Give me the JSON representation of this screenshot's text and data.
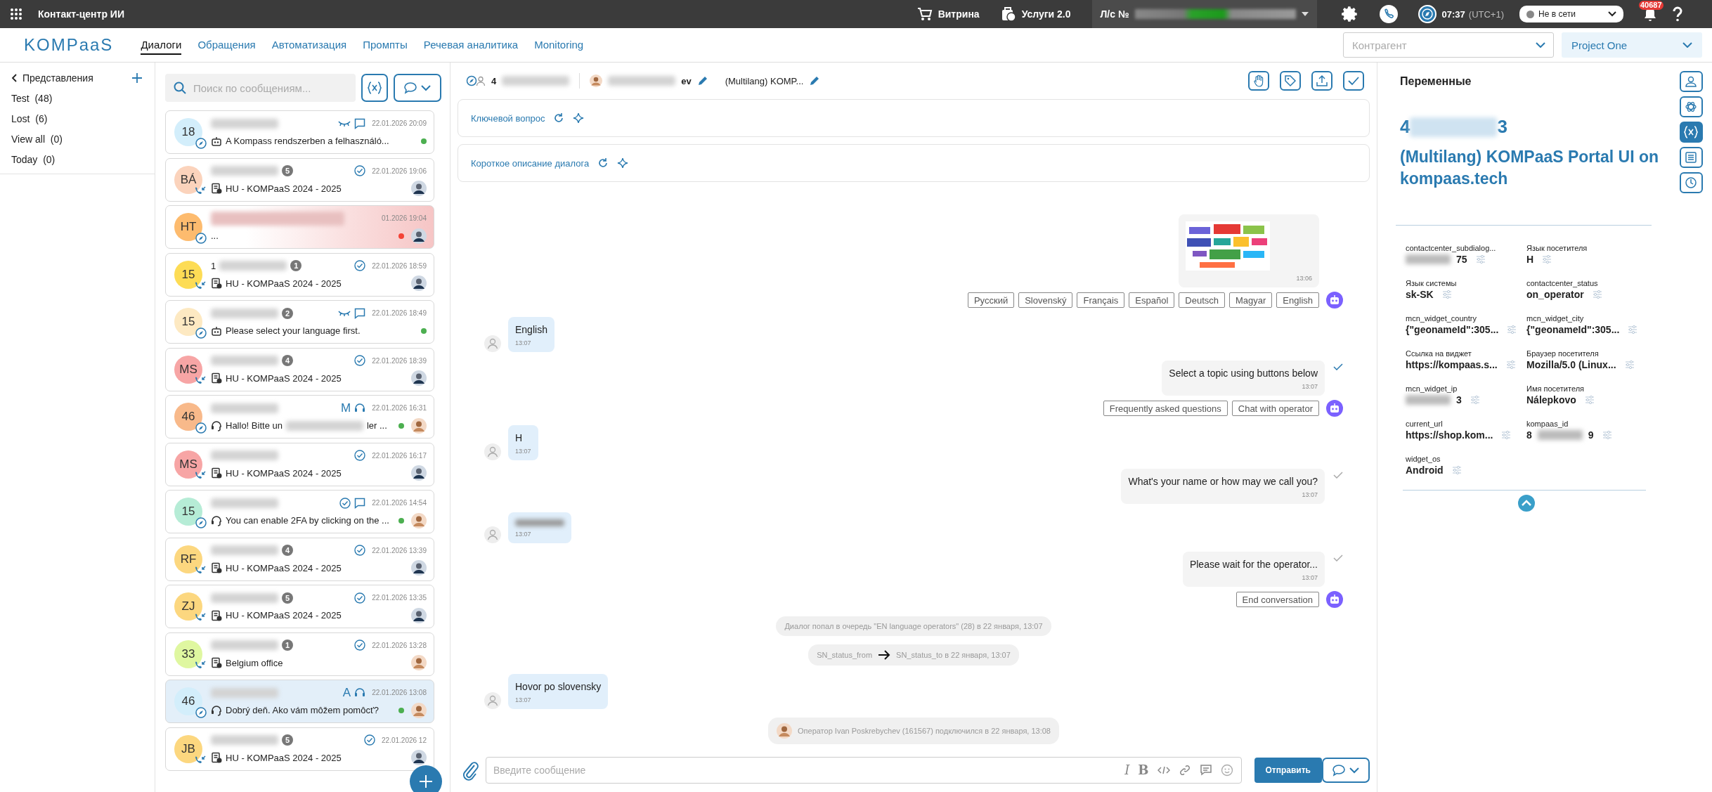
{
  "topbar": {
    "app_title": "Контакт-центр ИИ",
    "links": [
      {
        "label": "Витрина",
        "kind": "cart"
      },
      {
        "label": "Услуги 2.0",
        "kind": "services"
      }
    ],
    "account": {
      "head": "Л/с №"
    },
    "time": "07:37",
    "timezone": "(UTC+1)",
    "status": {
      "label": "Не в сети",
      "online": false
    },
    "notifications": "40687"
  },
  "nav": {
    "logo": "KOMPaaS",
    "tabs": [
      {
        "label": "Диалоги",
        "selected": true
      },
      {
        "label": "Обращения",
        "selected": false
      },
      {
        "label": "Автоматизация",
        "selected": false
      },
      {
        "label": "Промпты",
        "selected": false
      },
      {
        "label": "Речевая аналитика",
        "selected": false
      },
      {
        "label": "Monitoring",
        "selected": false
      }
    ],
    "counterparty": {
      "placeholder": "Контрагент"
    },
    "project": "Project One"
  },
  "views": {
    "title": "Представления",
    "items": [
      {
        "label": "Test",
        "count": "(48)"
      },
      {
        "label": "Lost",
        "count": "(6)"
      },
      {
        "label": "View all",
        "count": "(0)"
      },
      {
        "label": "Today",
        "count": "(0)"
      }
    ]
  },
  "search": {
    "placeholder": "Поиск по сообщениям..."
  },
  "dialogs": [
    {
      "initials": "18",
      "color": "#d3eefb",
      "channel": {
        "kind": "widget"
      },
      "markers": [
        {
          "kind": "eye"
        },
        {
          "kind": "chat"
        }
      ],
      "date": "22.01.2026 20:09",
      "preview_icon": {
        "kind": "bot"
      },
      "preview": "A Kompass rendszerben a felhasználó...",
      "dot": {
        "color": "#4caf50"
      },
      "selected": false,
      "alert": false
    },
    {
      "initials": "BÁ",
      "color": "#fbd3bc",
      "channel": {
        "kind": "phone"
      },
      "badge": "5",
      "markers": [
        {
          "kind": "check"
        }
      ],
      "date": "22.01.2026 19:06",
      "preview_icon": {
        "kind": "task"
      },
      "preview": "HU - KOMPaaS 2024 - 2025",
      "operator": {
        "kind": "dark"
      },
      "selected": false,
      "alert": false
    },
    {
      "initials": "HT",
      "color": "#fdbb6e",
      "channel": {
        "kind": "widget"
      },
      "date": "01.2026 19:04",
      "preview": "...",
      "dot": {
        "color": "#f44336"
      },
      "operator": {
        "kind": "dark"
      },
      "selected": false,
      "alert": true
    },
    {
      "initials": "15",
      "color": "#fddc55",
      "channel": {
        "kind": "phone"
      },
      "name_head": "1",
      "badge": "1",
      "markers": [
        {
          "kind": "check"
        }
      ],
      "date": "22.01.2026 18:59",
      "preview_icon": {
        "kind": "task"
      },
      "preview": "HU - KOMPaaS 2024 - 2025",
      "operator": {
        "kind": "dark"
      },
      "selected": false,
      "alert": false
    },
    {
      "initials": "15",
      "color": "#fde9c2",
      "channel": {
        "kind": "widget"
      },
      "badge": "2",
      "markers": [
        {
          "kind": "eye"
        },
        {
          "kind": "chat"
        }
      ],
      "date": "22.01.2026 18:49",
      "preview_icon": {
        "kind": "bot"
      },
      "preview": "Please select your language first.",
      "dot": {
        "color": "#4caf50"
      },
      "selected": false,
      "alert": false
    },
    {
      "initials": "MS",
      "color": "#f7a5a5",
      "channel": {
        "kind": "phone"
      },
      "badge": "4",
      "markers": [
        {
          "kind": "check"
        }
      ],
      "date": "22.01.2026 18:39",
      "preview_icon": {
        "kind": "task"
      },
      "preview": "HU - KOMPaaS 2024 - 2025",
      "operator": {
        "kind": "dark"
      },
      "selected": false,
      "alert": false
    },
    {
      "initials": "46",
      "color": "#f8b98a",
      "channel": {
        "kind": "widget"
      },
      "letter": "M",
      "markers": [
        {
          "kind": "headset"
        }
      ],
      "date": "22.01.2026 16:31",
      "preview_icon": {
        "kind": "headset"
      },
      "preview": "Hallo! Bitte un",
      "preview_tail": "ler ...",
      "dot": {
        "color": "#4caf50"
      },
      "operator": {
        "kind": "light"
      },
      "selected": false,
      "alert": false
    },
    {
      "initials": "MS",
      "color": "#f7a5a5",
      "channel": {
        "kind": "phone"
      },
      "markers": [
        {
          "kind": "check"
        }
      ],
      "date": "22.01.2026 16:17",
      "preview_icon": {
        "kind": "task"
      },
      "preview": "HU - KOMPaaS 2024 - 2025",
      "operator": {
        "kind": "dark"
      },
      "selected": false,
      "alert": false
    },
    {
      "initials": "15",
      "color": "#b6ecd6",
      "channel": {
        "kind": "widget"
      },
      "markers": [
        {
          "kind": "check"
        },
        {
          "kind": "chat"
        }
      ],
      "date": "22.01.2026 14:54",
      "preview_icon": {
        "kind": "headset"
      },
      "preview": "You can enable 2FA by clicking on the ...",
      "dot": {
        "color": "#4caf50"
      },
      "operator": {
        "kind": "light"
      },
      "selected": false,
      "alert": false
    },
    {
      "initials": "RF",
      "color": "#fcd77f",
      "channel": {
        "kind": "phone"
      },
      "badge": "4",
      "markers": [
        {
          "kind": "check"
        }
      ],
      "date": "22.01.2026 13:39",
      "preview_icon": {
        "kind": "task"
      },
      "preview": "HU - KOMPaaS 2024 - 2025",
      "operator": {
        "kind": "dark"
      },
      "selected": false,
      "alert": false
    },
    {
      "initials": "ZJ",
      "color": "#fcd77f",
      "channel": {
        "kind": "phone"
      },
      "badge": "5",
      "markers": [
        {
          "kind": "check"
        }
      ],
      "date": "22.01.2026 13:35",
      "preview_icon": {
        "kind": "task"
      },
      "preview": "HU - KOMPaaS 2024 - 2025",
      "operator": {
        "kind": "dark"
      },
      "selected": false,
      "alert": false
    },
    {
      "initials": "33",
      "color": "#dff7a0",
      "channel": {
        "kind": "phone"
      },
      "badge": "1",
      "markers": [
        {
          "kind": "check"
        }
      ],
      "date": "22.01.2026 13:28",
      "preview_icon": {
        "kind": "task"
      },
      "preview": "Belgium office",
      "operator": {
        "kind": "light"
      },
      "selected": false,
      "alert": false
    },
    {
      "initials": "46",
      "color": "#d3eefb",
      "channel": {
        "kind": "widget"
      },
      "letter": "A",
      "markers": [
        {
          "kind": "headset"
        }
      ],
      "date": "22.01.2026 13:08",
      "preview_icon": {
        "kind": "headset"
      },
      "preview": "Dobrý deň. Ako vám môžem pomôcť?",
      "dot": {
        "color": "#4caf50"
      },
      "operator": {
        "kind": "light"
      },
      "selected": true,
      "alert": false
    },
    {
      "initials": "JB",
      "color": "#fcd77f",
      "channel": {
        "kind": "phone"
      },
      "badge": "5",
      "markers": [
        {
          "kind": "check"
        }
      ],
      "date": "22.01.2026 12",
      "preview_icon": {
        "kind": "task"
      },
      "preview": "HU - KOMPaaS 2024 - 2025",
      "operator": {
        "kind": "dark"
      },
      "selected": false,
      "alert": false
    }
  ],
  "chat": {
    "header": {
      "contact_head": "4",
      "operator_tail": "ev",
      "title": "(Multilang) KOMP..."
    },
    "summaries": [
      {
        "label": "Ключевой вопрос"
      },
      {
        "label": "Короткое описание диалога"
      }
    ],
    "messages": [
      {
        "time": "13:06"
      },
      {
        "kind": "buttons",
        "buttons": [
          "Русский",
          "Slovenský",
          "Français",
          "Español",
          "Deutsch",
          "Magyar",
          "English"
        ]
      },
      {
        "kind": "user",
        "text": "English",
        "time": "13:07"
      },
      {
        "kind": "bot",
        "text": "Select a topic using buttons below",
        "time": "13:07",
        "read": true
      },
      {
        "kind": "buttons",
        "buttons": [
          "Frequently asked questions",
          "Chat with operator"
        ]
      },
      {
        "kind": "user",
        "text": "H",
        "time": "13:07"
      },
      {
        "kind": "bot",
        "text": "What's your name or how may we call you?",
        "time": "13:07",
        "read": false
      },
      {
        "kind": "user",
        "time": "13:07"
      },
      {
        "kind": "bot",
        "text": "Please wait for the operator...",
        "time": "13:07",
        "read": false
      },
      {
        "kind": "buttons",
        "buttons": [
          "End conversation"
        ]
      },
      {
        "kind": "system",
        "text": "Диалог попал в очередь \"EN language operators\" (28) в 22 января, 13:07"
      },
      {
        "kind": "status",
        "from": "SN_status_from",
        "to": "SN_status_to в 22 января, 13:07"
      },
      {
        "kind": "user",
        "text": "Hovor po slovensky",
        "time": "13:07"
      },
      {
        "kind": "operator",
        "text": "Оператор Ivan Poskrebychev (161567) подключился в 22 января, 13:08"
      }
    ],
    "composer": {
      "placeholder": "Введите сообщение",
      "format": [
        {
          "kind": "italic",
          "glyph": "I"
        },
        {
          "kind": "bold",
          "glyph": "B"
        },
        {
          "kind": "code"
        },
        {
          "kind": "link"
        },
        {
          "kind": "comment"
        },
        {
          "kind": "emoji"
        }
      ],
      "send": "Отправить"
    }
  },
  "variables": {
    "title": "Переменные",
    "contact_head": "4",
    "contact_tail": "3",
    "site": "(Multilang) KOMPaaS Portal UI on kompaas.tech",
    "items": [
      {
        "label": "contactcenter_subdialog...",
        "tail": "75"
      },
      {
        "label": "Язык посетителя",
        "value": "H"
      },
      {
        "label": "Язык системы",
        "value": "sk-SK"
      },
      {
        "label": "contactcenter_status",
        "value": "on_operator"
      },
      {
        "label": "mcn_widget_country",
        "value": "{\"geonameId\":305..."
      },
      {
        "label": "mcn_widget_city",
        "value": "{\"geonameId\":305..."
      },
      {
        "label": "Ссылка на виджет",
        "value": "https://kompaas.s..."
      },
      {
        "label": "Браузер посетителя",
        "value": "Mozilla/5.0 (Linux..."
      },
      {
        "label": "mcn_widget_ip",
        "tail": "3"
      },
      {
        "label": "Имя посетителя",
        "value": "Nálepkovo"
      },
      {
        "label": "current_url",
        "value": "https://shop.kom..."
      },
      {
        "label": "kompaas_id",
        "head": "8",
        "tail": "9"
      },
      {
        "label": "widget_os",
        "value": "Android"
      }
    ]
  },
  "side_tools": [
    {
      "kind": "person",
      "selected": false
    },
    {
      "kind": "ai",
      "selected": false
    },
    {
      "kind": "variables",
      "selected": true
    },
    {
      "kind": "notes",
      "selected": false
    },
    {
      "kind": "history",
      "selected": false
    }
  ]
}
